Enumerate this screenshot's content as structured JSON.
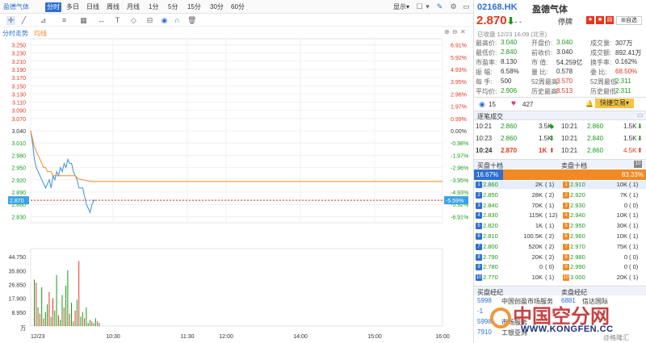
{
  "toolbar": {
    "stock_tab": "盈德气体",
    "tabs": [
      "分时",
      "多日",
      "日线",
      "周线",
      "月线",
      "1分",
      "5分",
      "15分",
      "30分",
      "60分"
    ],
    "active_tab": "分时",
    "display_label": "显示",
    "subbar_left": "分时走势",
    "subbar_avg": "均线"
  },
  "colors": {
    "accent": "#2e6fd1",
    "up": "#e8341c",
    "down": "#1a9a1a",
    "orange": "#f08a24"
  },
  "chart_data": [
    {
      "type": "line",
      "y_ticks": [
        "3.250",
        "3.230",
        "3.210",
        "3.190",
        "3.170",
        "3.150",
        "3.130",
        "3.110",
        "3.090",
        "3.070",
        "3.040",
        "3.010",
        "2.980",
        "2.950",
        "2.920",
        "2.890",
        "2.870",
        "2.860",
        "2.830"
      ],
      "pct_ticks": [
        "6.91%",
        "5.92%",
        "4.93%",
        "3.95%",
        "2.96%",
        "1.97%",
        "0.99%",
        "0.00%",
        "-0.98%",
        "-1.97%",
        "-2.96%",
        "-3.95%",
        "-4.93%",
        "-5.59%",
        "-5.92%",
        "-6.91%"
      ],
      "x_labels": [
        "12/23",
        "10:30",
        "11:30",
        "12:00",
        "14:00",
        "15:00",
        "16:00"
      ],
      "ylim": [
        2.815,
        3.265
      ],
      "prev_close": 3.04,
      "current": 2.87,
      "series": [
        {
          "values": [
            3.04,
            3.01,
            2.97,
            2.95,
            2.94,
            2.93,
            2.92,
            2.91,
            2.9,
            2.91,
            2.92,
            2.9,
            2.93,
            2.92,
            2.94,
            2.93,
            2.95,
            2.94,
            2.96,
            2.95,
            2.97,
            2.96,
            2.96,
            2.94,
            2.93,
            2.92,
            2.9,
            2.9,
            2.9,
            2.88,
            2.86,
            2.85,
            2.84,
            2.86,
            2.87,
            2.87
          ]
        },
        {
          "values": [
            3.04,
            3.02,
            3.0,
            2.99,
            2.98,
            2.97,
            2.96,
            2.95,
            2.95,
            2.94,
            2.94,
            2.94,
            2.93,
            2.93,
            2.93,
            2.93,
            2.93,
            2.93,
            2.93,
            2.93,
            2.93,
            2.93,
            2.93,
            2.93,
            2.93,
            2.925,
            2.922,
            2.921,
            2.92,
            2.919,
            2.918,
            2.917,
            2.917,
            2.916,
            2.916,
            2.916
          ]
        }
      ]
    },
    {
      "type": "bar",
      "y_ticks": [
        "44.750",
        "35.800",
        "26.850",
        "17.900",
        "8.950",
        "万"
      ],
      "ylim": [
        0,
        50
      ],
      "bars": [
        {
          "v": 30,
          "c": "g"
        },
        {
          "v": 28,
          "c": "r"
        },
        {
          "v": 12,
          "c": "g"
        },
        {
          "v": 8,
          "c": "r"
        },
        {
          "v": 25,
          "c": "g"
        },
        {
          "v": 5,
          "c": "r"
        },
        {
          "v": 9,
          "c": "g"
        },
        {
          "v": 14,
          "c": "g"
        },
        {
          "v": 22,
          "c": "r"
        },
        {
          "v": 6,
          "c": "g"
        },
        {
          "v": 18,
          "c": "r"
        },
        {
          "v": 10,
          "c": "g"
        },
        {
          "v": 33,
          "c": "g"
        },
        {
          "v": 7,
          "c": "r"
        },
        {
          "v": 4,
          "c": "g"
        },
        {
          "v": 20,
          "c": "g"
        },
        {
          "v": 12,
          "c": "r"
        },
        {
          "v": 26,
          "c": "g"
        },
        {
          "v": 36,
          "c": "g"
        },
        {
          "v": 8,
          "c": "r"
        },
        {
          "v": 15,
          "c": "g"
        },
        {
          "v": 3,
          "c": "g"
        },
        {
          "v": 10,
          "c": "r"
        },
        {
          "v": 17,
          "c": "g"
        },
        {
          "v": 42,
          "c": "r"
        },
        {
          "v": 6,
          "c": "g"
        },
        {
          "v": 9,
          "c": "g"
        },
        {
          "v": 5,
          "c": "r"
        },
        {
          "v": 12,
          "c": "g"
        },
        {
          "v": 2,
          "c": "g"
        },
        {
          "v": 4,
          "c": "g"
        },
        {
          "v": 3,
          "c": "r"
        },
        {
          "v": 2,
          "c": "g"
        },
        {
          "v": 5,
          "c": "g"
        },
        {
          "v": 3,
          "c": "r"
        },
        {
          "v": 2,
          "c": "g"
        }
      ]
    }
  ],
  "quote": {
    "code": "02168.HK",
    "name": "盈德气体",
    "price": "2.870",
    "status": "停牌",
    "time": "已收盘 12/23 16:09 (北京)",
    "custom_label": "自选",
    "fields": [
      [
        "最高价:",
        "3.040",
        "开盘价:",
        "3.040",
        "成交量:",
        "307万"
      ],
      [
        "最低价:",
        "2.840",
        "前收价:",
        "3.040",
        "成交额:",
        "892.41万"
      ],
      [
        "市盈率:",
        "8.130",
        "市  值:",
        "54.259亿",
        "换手率:",
        "0.162%"
      ],
      [
        "振  幅:",
        "6.58%",
        "量  比:",
        "0.578",
        "委  比:",
        "68.50%"
      ],
      [
        "每  手:",
        "500",
        "52周最高:",
        "3.570",
        "52周最低:",
        "2.311"
      ],
      [
        "平均价:",
        "2.906",
        "历史最高:",
        "8.513",
        "历史最低:",
        "2.311"
      ]
    ],
    "views": "15",
    "likes": "427",
    "quick_trade": "快捷交易"
  },
  "trades": {
    "title": "逐笔成交",
    "rows": [
      [
        "10:21",
        "2.860",
        "3.5K",
        "10:21",
        "2.860",
        "1.5K"
      ],
      [
        "10:23",
        "2.860",
        "1.5K",
        "10:21",
        "2.840",
        "1.5K"
      ],
      [
        "10:24",
        "2.870",
        "1K",
        "10:21",
        "2.860",
        "4.5K"
      ]
    ]
  },
  "book": {
    "buy_title": "买盘十档",
    "sell_title": "卖盘十档",
    "buy_pct": "16.67%",
    "sell_pct": "83.33%",
    "bids": [
      [
        "2.860",
        "2K",
        "1"
      ],
      [
        "2.850",
        "28K",
        "2"
      ],
      [
        "2.840",
        "70K",
        "1"
      ],
      [
        "2.830",
        "115K",
        "12"
      ],
      [
        "2.820",
        "1K",
        "1"
      ],
      [
        "2.810",
        "100.5K",
        "2"
      ],
      [
        "2.800",
        "520K",
        "2"
      ],
      [
        "2.790",
        "20K",
        "2"
      ],
      [
        "2.780",
        "0",
        "0"
      ],
      [
        "2.770",
        "10K",
        "1"
      ]
    ],
    "asks": [
      [
        "2.910",
        "10K",
        "1"
      ],
      [
        "2.920",
        "7K",
        "1"
      ],
      [
        "2.930",
        "0",
        "0"
      ],
      [
        "2.940",
        "10K",
        "1"
      ],
      [
        "2.950",
        "30K",
        "1"
      ],
      [
        "2.960",
        "10K",
        "1"
      ],
      [
        "2.970",
        "75K",
        "1"
      ],
      [
        "2.980",
        "0",
        "0"
      ],
      [
        "2.990",
        "0",
        "0"
      ],
      [
        "3.000",
        "20K",
        "1"
      ]
    ]
  },
  "brokers": {
    "buy_title": "买盘经纪",
    "sell_title": "卖盘经纪",
    "buy": [
      [
        "5998",
        "中国创盈市场服务"
      ],
      [
        "-1",
        ""
      ],
      [
        "5998",
        "市场服务"
      ],
      [
        "7910",
        "工银亚洲"
      ]
    ],
    "sell": [
      [
        "6881",
        "信达国际"
      ]
    ]
  },
  "watermark": {
    "cn": "中国空分网",
    "en": "WWW.KONGFEN.CC",
    "tag": "@格隆汇"
  }
}
